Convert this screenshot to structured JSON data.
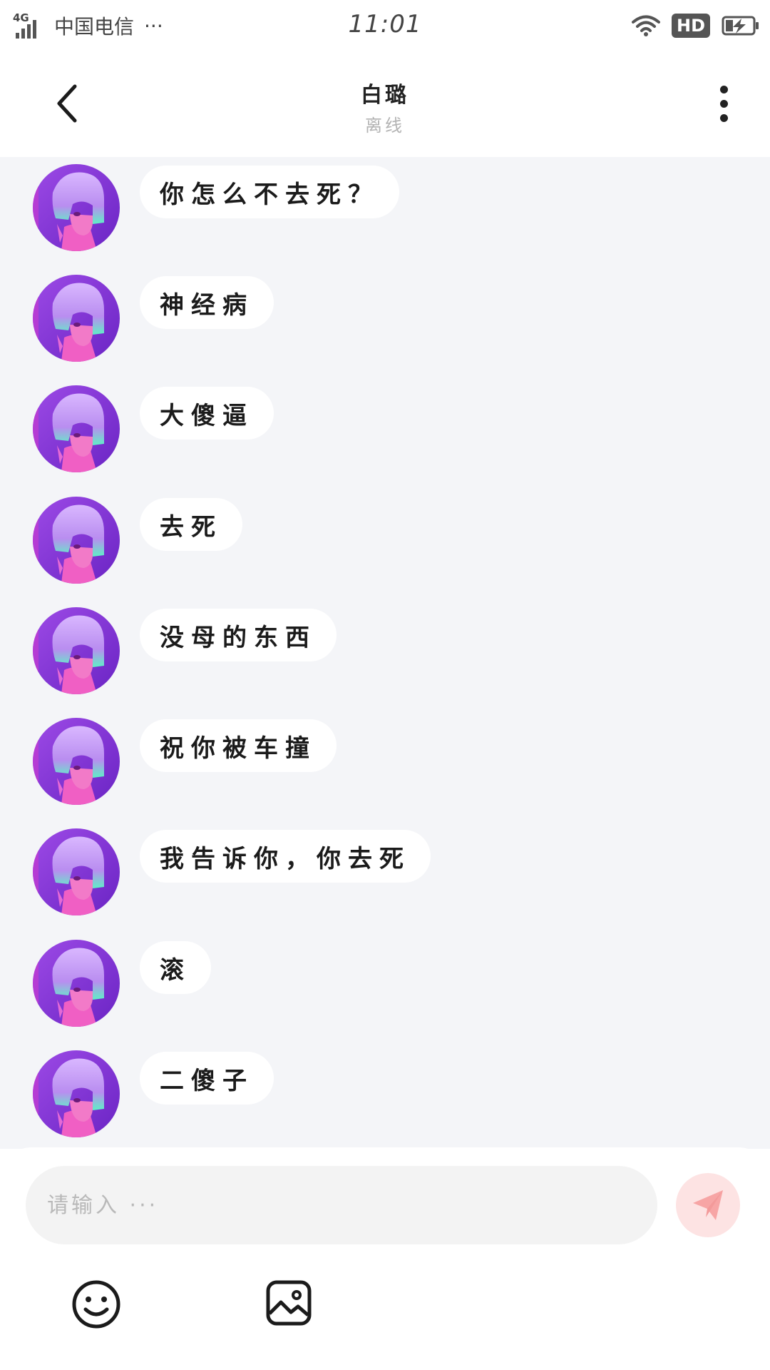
{
  "status_bar": {
    "network": "4G",
    "carrier": "中国电信",
    "more": "···",
    "time": "11:01",
    "hd": "HD"
  },
  "header": {
    "back_icon": "chevron-left-icon",
    "name": "白璐",
    "status": "离线",
    "more_icon": "vertical-dots-icon"
  },
  "messages": [
    {
      "text": "你怎么不去死？"
    },
    {
      "text": "神经病"
    },
    {
      "text": "大傻逼"
    },
    {
      "text": "去死"
    },
    {
      "text": "没母的东西"
    },
    {
      "text": "祝你被车撞"
    },
    {
      "text": "我告诉你，你去死"
    },
    {
      "text": "滚"
    },
    {
      "text": "二傻子"
    }
  ],
  "input": {
    "placeholder": "请输入 ···",
    "value": ""
  },
  "toolbar": {
    "emoji_icon": "smiley-icon",
    "image_icon": "image-icon",
    "send_icon": "paper-plane-icon"
  },
  "colors": {
    "chat_background": "#f4f5f8",
    "bubble": "#ffffff",
    "send_button": "#fde3e3",
    "send_icon": "#f7a5a5",
    "avatar_purple": "#8a3ad8",
    "avatar_pink": "#f05fc4"
  }
}
